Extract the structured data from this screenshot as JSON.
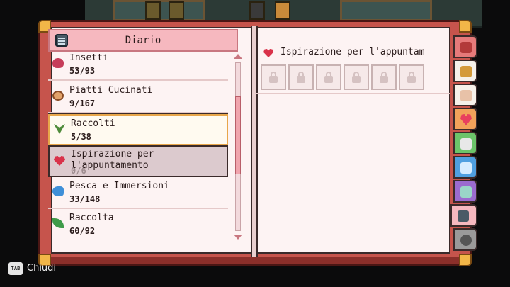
{
  "journal": {
    "title": "Diario",
    "categories": [
      {
        "name": "Insetti",
        "count": "53/93",
        "icon": "bug-icon"
      },
      {
        "name": "Piatti Cucinati",
        "count": "9/167",
        "icon": "dish-icon"
      },
      {
        "name": "Raccolti",
        "count": "5/38",
        "icon": "sprout-icon"
      },
      {
        "name": "Ispirazione per l'appuntamento",
        "count": "0/6",
        "icon": "heart-icon"
      },
      {
        "name": "Pesca e Immersioni",
        "count": "33/148",
        "icon": "fish-icon"
      },
      {
        "name": "Raccolta",
        "count": "60/92",
        "icon": "leaf-icon"
      }
    ],
    "selected_index": 2,
    "highlighted_index": 3
  },
  "detail": {
    "title": "Ispirazione per l'appuntam",
    "icon": "heart-icon",
    "slots": [
      "lock-icon",
      "lock-icon",
      "lock-icon",
      "lock-icon",
      "lock-icon",
      "lock-icon"
    ]
  },
  "tabs": [
    {
      "icon": "backpack-icon",
      "color": "#e67a7a"
    },
    {
      "icon": "shirt-icon",
      "color": "#f6f1ea"
    },
    {
      "icon": "character-icon",
      "color": "#f6f1ea"
    },
    {
      "icon": "heart-icon",
      "color": "#f2a25a"
    },
    {
      "icon": "map-icon",
      "color": "#6cc46a"
    },
    {
      "icon": "snowflake-icon",
      "color": "#4f9fe0"
    },
    {
      "icon": "calendar-icon",
      "color": "#9b6bcf"
    },
    {
      "icon": "journal-icon",
      "color": "#f6b8bf"
    },
    {
      "icon": "gear-icon",
      "color": "#9a9a9a"
    }
  ],
  "active_tab": 7,
  "footer": {
    "key_label": "TAB",
    "close_label": "Chiudi"
  },
  "colors": {
    "cover": "#c6544c",
    "page": "#fdf3f3",
    "header": "#f6b8bf",
    "selection_border": "#e8a64a"
  }
}
